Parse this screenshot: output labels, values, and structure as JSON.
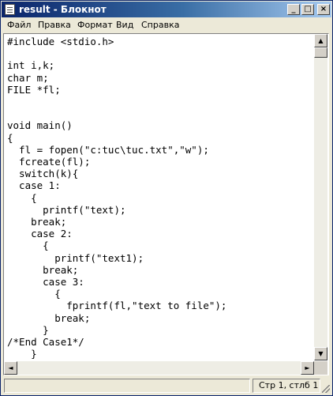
{
  "window": {
    "title": "result - Блокнот",
    "controls": {
      "minimize": "_",
      "maximize": "□",
      "close": "×"
    }
  },
  "menu": [
    {
      "label": "Файл"
    },
    {
      "label": "Правка"
    },
    {
      "label": "Формат"
    },
    {
      "label": "Вид"
    },
    {
      "label": "Справка"
    }
  ],
  "editor": {
    "content": "#include <stdio.h>\n\nint i,k;\nchar m;\nFILE *fl;\n\n\nvoid main()\n{\n  fl = fopen(\"c:tuc\\tuc.txt\",\"w\");\n  fcreate(fl);\n  switch(k){\n  case 1:\n    {\n      printf(\"text);\n    break;\n    case 2:\n      {\n        printf(\"text1);\n      break;\n      case 3:\n        {\n          fprintf(fl,\"text to file\");\n        break;\n      }\n/*End Case1*/\n    }"
  },
  "scrollbars": {
    "up_icon": "arrow-up",
    "down_icon": "arrow-down",
    "left_icon": "arrow-left",
    "right_icon": "arrow-right",
    "glyph_up": "▲",
    "glyph_down": "▼",
    "glyph_left": "◄",
    "glyph_right": "►"
  },
  "status": {
    "position": "Стр 1, стлб 1"
  },
  "colors": {
    "titlebar_start": "#0a246a",
    "titlebar_end": "#a6caf0",
    "chrome": "#ece9d8"
  }
}
